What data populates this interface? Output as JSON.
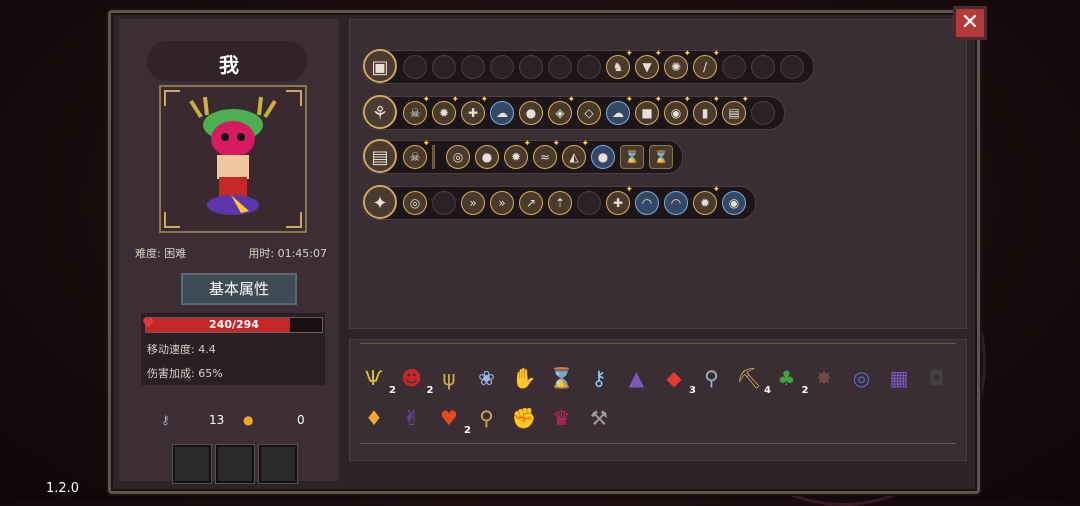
{
  "character": {
    "name": "我",
    "difficulty": "难度: 困难",
    "time": "用时: 01:45:07",
    "attr_button": "基本属性",
    "hp_text": "240/294",
    "hp_fraction": 0.816,
    "move_speed": "移动速度: 4.4",
    "damage_bonus": "伤害加成: 65%",
    "keys": "13",
    "coins": "0"
  },
  "version": "1.2.0",
  "close_label": "✕",
  "colors": {
    "frame": "#2e2329",
    "gold_border": "#c9a85f",
    "hp": "#c62828",
    "close": "#b33a3a"
  },
  "weapons": [
    {
      "icon": "chest-icon",
      "glyph": "▣",
      "slots": [
        "",
        "",
        "",
        "",
        "",
        "",
        "",
        "cat-icon*",
        "crest-icon*",
        "burst-icon*",
        "blade-icon*",
        "",
        "",
        ""
      ]
    },
    {
      "icon": "staff-icon",
      "glyph": "⚘",
      "slots": [
        "skull-icon*",
        "flame-icon*",
        "cross-icon*",
        "ghost-icon",
        "slime-icon",
        "gem-icon*",
        "rune-icon",
        "ghost2-icon*",
        "block-icon*",
        "eye-icon*",
        "vial-icon*",
        "book-icon*",
        ""
      ]
    },
    {
      "icon": "tome-icon",
      "glyph": "▤",
      "slots": [
        "skull-icon*",
        "|",
        "target-icon",
        "slime-icon",
        "flame-icon*",
        "water-icon*",
        "prism-icon*",
        "coin-icon",
        "hourglass-icon",
        "hourglass-icon"
      ]
    },
    {
      "icon": "scepter-icon",
      "glyph": "✦",
      "slots": [
        "target-icon",
        "",
        "dash-icon",
        "chevron-icon",
        "arrow-icon",
        "up-icon",
        "",
        "cross-icon*",
        "wave-icon",
        "wave-icon",
        "flame-icon*",
        "vortex-icon"
      ]
    }
  ],
  "items": [
    {
      "name": "antler-icon",
      "glyph": "Ѱ",
      "count": "2"
    },
    {
      "name": "demon-icon",
      "glyph": "☻",
      "count": "2"
    },
    {
      "name": "horn-icon",
      "glyph": "ψ",
      "count": ""
    },
    {
      "name": "lotus-icon",
      "glyph": "❀",
      "count": ""
    },
    {
      "name": "claw-icon",
      "glyph": "✋",
      "count": ""
    },
    {
      "name": "hourglass-icon",
      "glyph": "⌛",
      "count": ""
    },
    {
      "name": "key-icon",
      "glyph": "⚷",
      "count": ""
    },
    {
      "name": "cloak-icon",
      "glyph": "▲",
      "count": ""
    },
    {
      "name": "fish-icon",
      "glyph": "◆",
      "count": "3"
    },
    {
      "name": "magnifier-icon",
      "glyph": "⚲",
      "count": ""
    },
    {
      "name": "pickaxe-icon",
      "glyph": "⛏",
      "count": "4"
    },
    {
      "name": "clover-icon",
      "glyph": "♣",
      "count": "2"
    },
    {
      "name": "spiky-icon",
      "glyph": "✸",
      "count": ""
    },
    {
      "name": "compass-icon",
      "glyph": "◎",
      "count": ""
    },
    {
      "name": "scroll-icon",
      "glyph": "▦",
      "count": ""
    },
    {
      "name": "bag-icon",
      "glyph": "◘",
      "count": ""
    },
    {
      "name": "crystal-icon",
      "glyph": "♦",
      "count": ""
    },
    {
      "name": "hand-icon",
      "glyph": "✌",
      "count": ""
    },
    {
      "name": "heart-icon",
      "glyph": "♥",
      "count": "2"
    },
    {
      "name": "ring-key-icon",
      "glyph": "⚲",
      "count": ""
    },
    {
      "name": "gauntlet-icon",
      "glyph": "✊",
      "count": ""
    },
    {
      "name": "mask-icon",
      "glyph": "♛",
      "count": ""
    },
    {
      "name": "axe-icon",
      "glyph": "⚒",
      "count": ""
    }
  ]
}
